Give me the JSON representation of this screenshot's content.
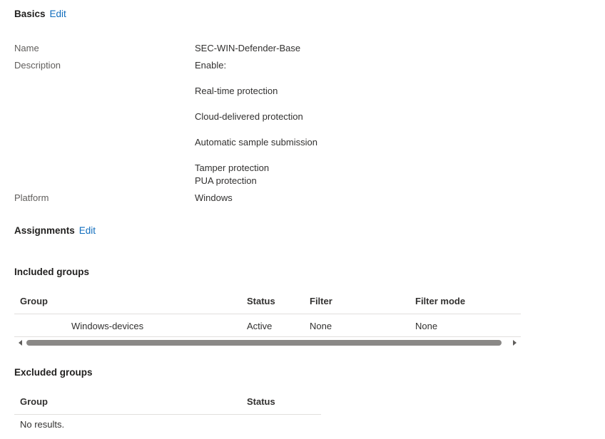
{
  "basics": {
    "title": "Basics",
    "edit_label": "Edit",
    "name_label": "Name",
    "name_value": "SEC-WIN-Defender-Base",
    "description_label": "Description",
    "description_lines": [
      "Enable:",
      "Real-time protection",
      "Cloud-delivered protection",
      "Automatic sample submission",
      "Tamper protection",
      "PUA protection"
    ],
    "platform_label": "Platform",
    "platform_value": "Windows"
  },
  "assignments": {
    "title": "Assignments",
    "edit_label": "Edit"
  },
  "included_groups": {
    "title": "Included groups",
    "columns": [
      "Group",
      "Status",
      "Filter",
      "Filter mode"
    ],
    "rows": [
      {
        "group": "Windows-devices",
        "status": "Active",
        "filter": "None",
        "filter_mode": "None"
      }
    ]
  },
  "excluded_groups": {
    "title": "Excluded groups",
    "columns": [
      "Group",
      "Status"
    ],
    "empty_text": "No results."
  },
  "colors": {
    "link": "#0f6cbd",
    "text": "#323130",
    "label": "#605e5c",
    "divider": "#e1dfdd",
    "scroll_thumb": "#8a8886"
  }
}
